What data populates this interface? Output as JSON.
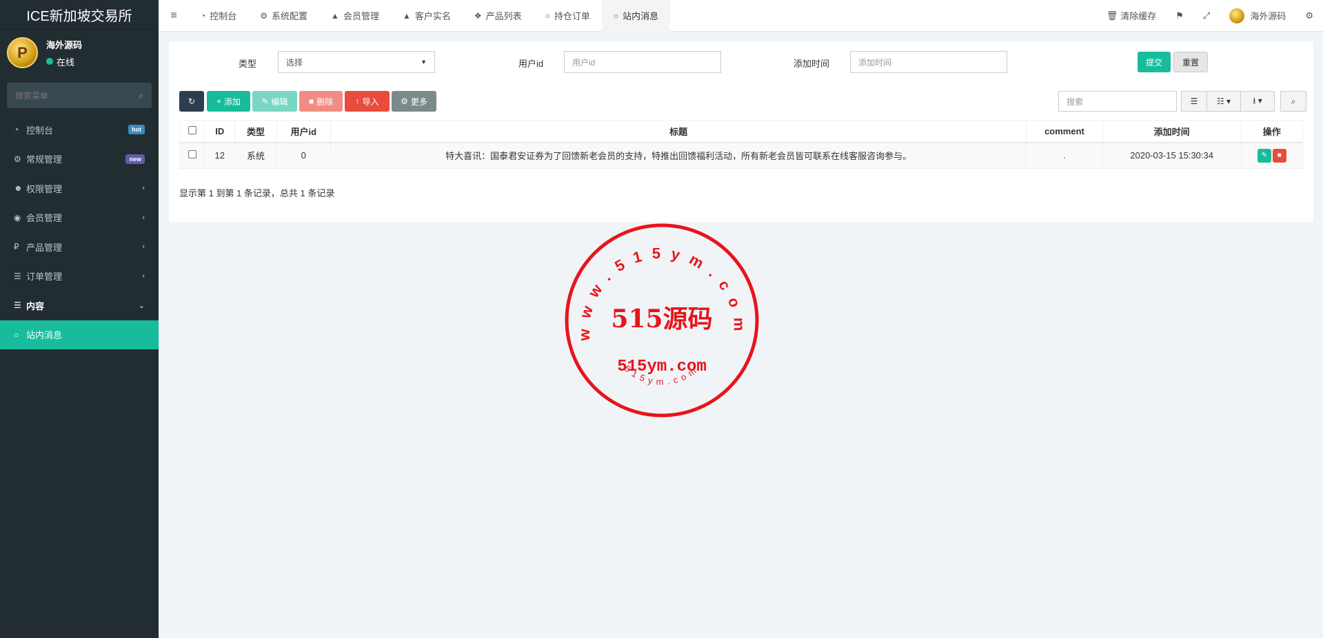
{
  "brand": "ICE新加坡交易所",
  "user": {
    "name": "海外源码",
    "status": "在线"
  },
  "sidebar": {
    "search_placeholder": "搜索菜单",
    "items": [
      {
        "label": "控制台",
        "icon": "dashboard-icon",
        "badge": "hot"
      },
      {
        "label": "常规管理",
        "icon": "cogs-icon",
        "badge": "new"
      },
      {
        "label": "权限管理",
        "icon": "group-icon",
        "arrow": "‹"
      },
      {
        "label": "会员管理",
        "icon": "user-circle-icon",
        "arrow": "‹"
      },
      {
        "label": "产品管理",
        "icon": "ruble-icon",
        "arrow": "‹"
      },
      {
        "label": "订单管理",
        "icon": "list-icon",
        "arrow": "‹"
      },
      {
        "label": "内容",
        "icon": "list-icon",
        "arrow": "⌄"
      },
      {
        "label": "站内消息",
        "icon": "circle-icon"
      }
    ]
  },
  "navbar": {
    "tabs": [
      {
        "label": "控制台",
        "icon": "dashboard-icon"
      },
      {
        "label": "系统配置",
        "icon": "gear-icon"
      },
      {
        "label": "会员管理",
        "icon": "user-icon"
      },
      {
        "label": "客户实名",
        "icon": "user-icon"
      },
      {
        "label": "产品列表",
        "icon": "cubes-icon"
      },
      {
        "label": "持仓订单",
        "icon": "circle-icon"
      },
      {
        "label": "站内消息",
        "icon": "circle-icon"
      }
    ],
    "clear_cache": "清除缓存",
    "user_name": "海外源码"
  },
  "filter": {
    "type_label": "类型",
    "type_value": "选择",
    "userid_label": "用户id",
    "userid_placeholder": "用户id",
    "time_label": "添加时间",
    "time_placeholder": "添加时间",
    "submit": "提交",
    "reset": "重置"
  },
  "toolbar": {
    "add": "添加",
    "edit": "编辑",
    "delete": "删除",
    "import": "导入",
    "more": "更多",
    "search_placeholder": "搜索"
  },
  "table": {
    "columns": [
      "ID",
      "类型",
      "用户id",
      "标题",
      "comment",
      "添加时间",
      "操作"
    ],
    "rows": [
      {
        "id": "12",
        "type": "系统",
        "userid": "0",
        "title": "特大喜讯：国泰君安证券为了回馈新老会员的支持，特推出回馈福利活动，所有新老会员皆可联系在线客服咨询参与。",
        "comment": ".",
        "time": "2020-03-15 15:30:34"
      }
    ],
    "summary": "显示第 1 到第 1 条记录，总共 1 条记录"
  },
  "watermark": {
    "ring_text": "www.515ym.com",
    "main": "515源码",
    "sub": "515ym.com",
    "bottom": "515ym.com",
    "color": "#e8141b"
  }
}
